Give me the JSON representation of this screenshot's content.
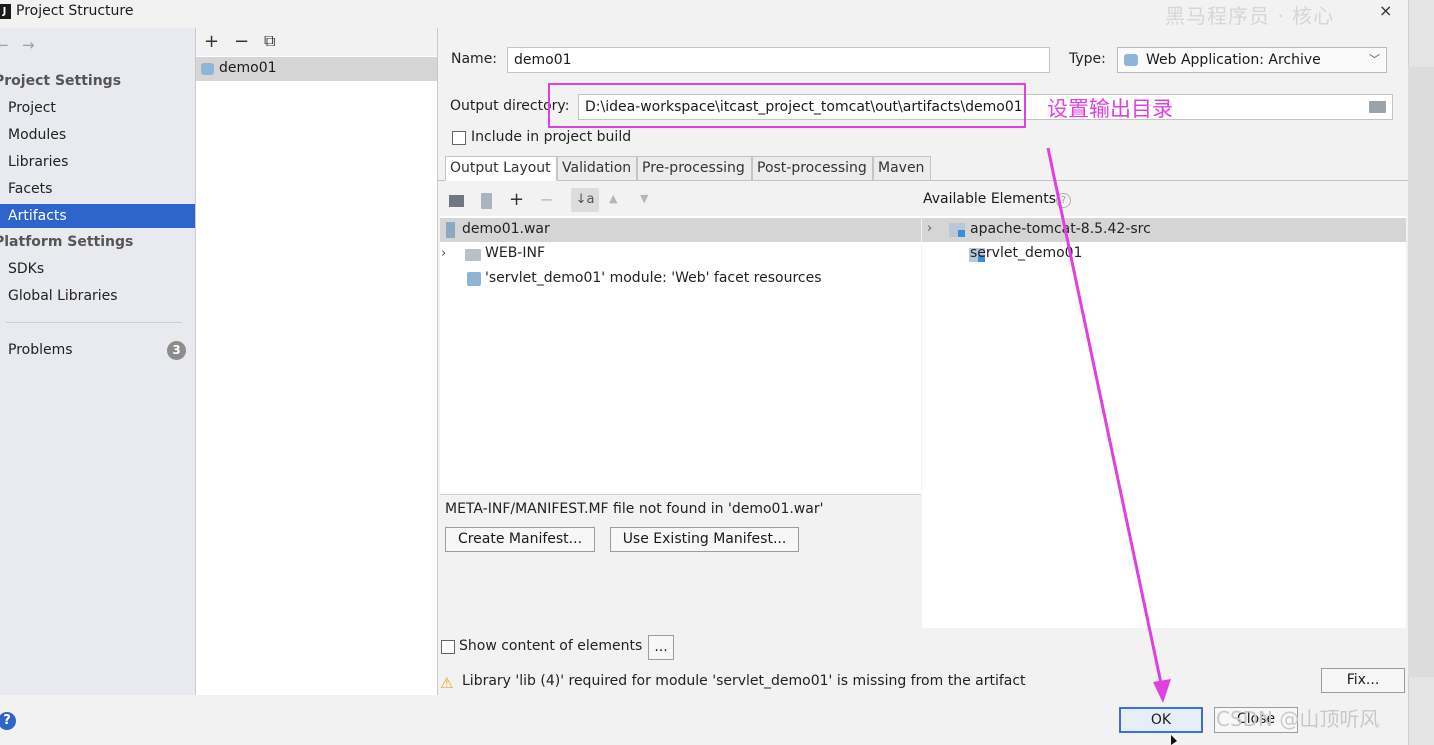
{
  "window": {
    "title": "Project Structure",
    "app_icon_glyph": "J",
    "close_glyph": "×",
    "watermark_top": "黑马程序员 · 核心"
  },
  "sidebar": {
    "back_glyph": "←",
    "forward_glyph": "→",
    "project_settings_header": "Project Settings",
    "project_items": [
      "Project",
      "Modules",
      "Libraries",
      "Facets",
      "Artifacts"
    ],
    "selected_item": "Artifacts",
    "platform_settings_header": "Platform Settings",
    "platform_items": [
      "SDKs",
      "Global Libraries"
    ],
    "problems_label": "Problems",
    "problems_count": "3"
  },
  "artifact_list": {
    "add_glyph": "+",
    "remove_glyph": "−",
    "copy_glyph": "⧉",
    "items": [
      "demo01"
    ]
  },
  "artifact": {
    "name_label": "Name:",
    "name_value": "demo01",
    "type_label": "Type:",
    "type_value": "Web Application: Archive",
    "output_dir_label": "Output directory:",
    "output_dir_value": "D:\\idea-workspace\\itcast_project_tomcat\\out\\artifacts\\demo01",
    "include_label": "Include in project build",
    "include_checked": false
  },
  "tabs": [
    "Output Layout",
    "Validation",
    "Pre-processing",
    "Post-processing",
    "Maven"
  ],
  "active_tab": "Output Layout",
  "output_layout": {
    "tree": [
      {
        "label": "demo01.war",
        "selected": true
      },
      {
        "label": "WEB-INF",
        "expandable": true
      },
      {
        "label": "'servlet_demo01' module: 'Web' facet resources"
      }
    ],
    "manifest_message": "META-INF/MANIFEST.MF file not found in 'demo01.war'",
    "create_manifest_label": "Create Manifest...",
    "use_existing_manifest_label": "Use Existing Manifest..."
  },
  "available_elements": {
    "header": "Available Elements",
    "items": [
      {
        "label": "apache-tomcat-8.5.42-src",
        "expandable": true,
        "selected": true
      },
      {
        "label": "servlet_demo01"
      }
    ]
  },
  "bottom": {
    "show_content_label": "Show content of elements",
    "show_content_checked": false,
    "ellipsis_label": "...",
    "warning_message": "Library 'lib (4)' required for module 'servlet_demo01' is missing from the artifact",
    "fix_label": "Fix...",
    "ok_label": "OK",
    "close_label": "Close",
    "help_glyph": "?",
    "watermark": "CSDN @山顶听风"
  },
  "annotation": {
    "text": "设置输出目录",
    "color": "#e040e0"
  },
  "colors": {
    "selection": "#2f65ca",
    "annotation": "#e040e0",
    "warning": "#f0a020"
  }
}
